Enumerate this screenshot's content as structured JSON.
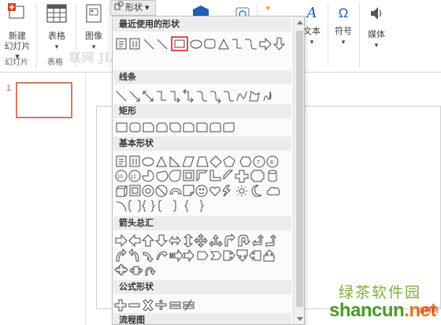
{
  "ribbon": {
    "new_slide_line1": "新建",
    "new_slide_line2": "幻灯片 ▾",
    "slides_group": "幻灯片",
    "table": "表格",
    "table_arrow": "▾",
    "tables_group": "表格",
    "image": "图像",
    "image_arrow": "▾",
    "shapes_button": "形状 ▾",
    "text": "文本",
    "text_arrow": "▾",
    "symbol": "符号",
    "symbol_arrow": "▾",
    "media": "媒体",
    "media_arrow": "▾",
    "watermark": "联网  JIAN.COM",
    "text_icon_glyph": "A",
    "symbol_icon_glyph": "Ω"
  },
  "gallery": {
    "sections": [
      "最近使用的形状",
      "线条",
      "矩形",
      "基本形状",
      "箭头总汇",
      "公式形状",
      "流程图"
    ]
  },
  "slide_pane": {
    "slide_number": "1"
  },
  "logo": {
    "top_text": "绿茶软件园",
    "main_text_a": "shancun",
    "main_text_b": ".net",
    "sub_text": "山村网"
  },
  "colors": {
    "selection_red": "#e02020",
    "shape_stroke": "#4a4a4a",
    "thumb_border": "#d27a5c",
    "logo_green": "#4c9a2a"
  }
}
